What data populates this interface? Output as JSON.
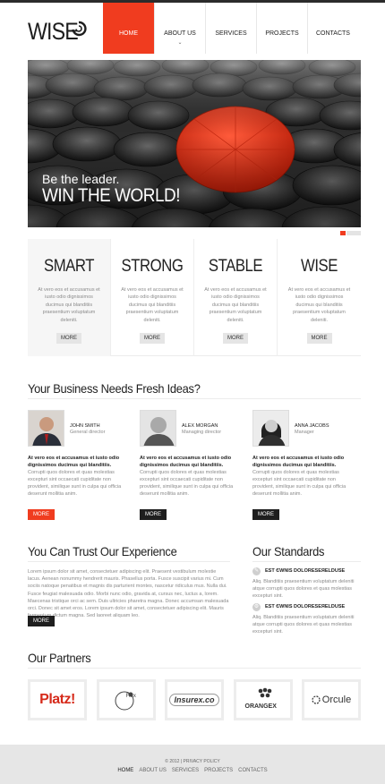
{
  "brand": {
    "logo": "WISE"
  },
  "nav": {
    "items": [
      {
        "label": "HOME"
      },
      {
        "label": "ABOUT US"
      },
      {
        "label": "SERVICES"
      },
      {
        "label": "PROJECTS"
      },
      {
        "label": "CONTACTS"
      }
    ],
    "active": "HOME"
  },
  "hero": {
    "line1": "Be the leader.",
    "line2": "WIN THE WORLD!"
  },
  "features": [
    {
      "title": "SMART",
      "text": "At vero eos et accusamus et iusto odio dignissimos ducimus qui blanditiis praesentium voluptatum deleniti.",
      "button": "MORE"
    },
    {
      "title": "STRONG",
      "text": "At vero eos et accusamus et iusto odio dignissimos ducimus qui blanditiis praesentium voluptatum deleniti.",
      "button": "MORE"
    },
    {
      "title": "STABLE",
      "text": "At vero eos et accusamus et iusto odio dignissimos ducimus qui blanditiis praesentium voluptatum deleniti.",
      "button": "MORE"
    },
    {
      "title": "WISE",
      "text": "At vero eos et accusamus et iusto odio dignissimos ducimus qui blanditiis praesentium voluptatum deleniti.",
      "button": "MORE"
    }
  ],
  "team": {
    "title": "Your Business Needs Fresh Ideas?",
    "members": [
      {
        "name": "JOHN SMITH",
        "role": "General director",
        "lead": "At vero eos et accusamus et iusto odio dignissimos ducimus qui blanditiis.",
        "text": "Corrupti quos dolores et quas molestias excepturi sint occaecati cupiditate non provident, similique sunt in culpa qui officia deserunt mollitia anim.",
        "button": "MORE"
      },
      {
        "name": "ALEX MORGAN",
        "role": "Managing director",
        "lead": "At vero eos et accusamus et iusto odio dignissimos ducimus qui blanditiis.",
        "text": "Corrupti quos dolores et quas molestias excepturi sint occaecati cupiditate non provident, similique sunt in culpa qui officia deserunt mollitia anim.",
        "button": "MORE"
      },
      {
        "name": "ANNA JACOBS",
        "role": "Manager",
        "lead": "At vero eos et accusamus et iusto odio dignissimos ducimus qui blanditiis.",
        "text": "Corrupti quos dolores et quas molestias excepturi sint occaecati cupiditate non provident, similique sunt in culpa qui officia deserunt mollitia anim.",
        "button": "MORE"
      }
    ]
  },
  "trust": {
    "title": "You Can Trust Our Experience",
    "text": "Lorem ipsum dolor sit amet, consectetuer adipiscing elit. Praesent vestibulum molestie lacus. Aenean nonummy hendrerit mauris. Phasellus porta. Fusce suscipit varius mi. Cum sociis natoque penatibus et magnis dis parturient montes, nascetur ridiculus mus. Nulla dui. Fusce feugiat malesuada odio. Morbi nunc odio, gravida at, cursus nec, luctus a, lorem. Maecenas tristique orci ac sem. Duis ultricies pharetra magna. Donec accumsan malesuada orci. Donec sit amet eros. Lorem ipsum dolor sit amet, consectetuer adipiscing elit. Mauris fermentum dictum magna. Sed laoreet aliquam leo.",
    "button": "MORE"
  },
  "standards": {
    "title": "Our Standards",
    "items": [
      {
        "title": "EST ЄWNIS DOLOREЅEЯELDUSE",
        "text": "Aliq. Blanditiis praesentium voluptatum deleniti atque corrupti quos dolores et quas molestias excepturi sint."
      },
      {
        "title": "EST ЄWNIS DOLOREЅEЯELDUSE",
        "text": "Aliq. Blanditiis praesentium voluptatum deleniti atque corrupti quos dolores et quas molestias excepturi sint."
      }
    ]
  },
  "partners": {
    "title": "Our Partners",
    "items": [
      {
        "name": "Platz!"
      },
      {
        "name": "Flex"
      },
      {
        "name": "Insurex.co"
      },
      {
        "name": "ORANGEX"
      },
      {
        "name": "Orcule"
      }
    ]
  },
  "footer": {
    "copyright": "© 2012 | PRIVACY POLICY",
    "nav": [
      "HOME",
      "ABOUT US",
      "SERVICES",
      "PROJECTS",
      "CONTACTS"
    ]
  },
  "colors": {
    "accent": "#f03c1f",
    "dark": "#1e1e1e",
    "footer": "#e6e6e6"
  }
}
